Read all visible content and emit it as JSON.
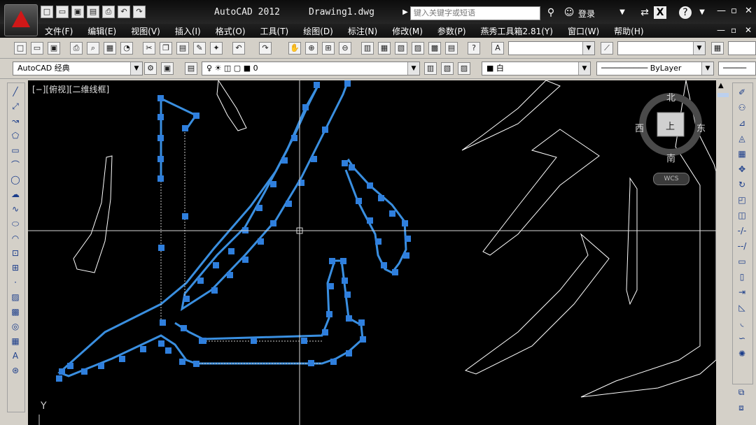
{
  "app": {
    "name": "AutoCAD 2012",
    "document": "Drawing1.dwg",
    "search_placeholder": "键入关键字或短语",
    "login": "登录"
  },
  "menu": [
    "文件(F)",
    "编辑(E)",
    "视图(V)",
    "插入(I)",
    "格式(O)",
    "工具(T)",
    "绘图(D)",
    "标注(N)",
    "修改(M)",
    "参数(P)",
    "燕秀工具箱2.81(Y)",
    "窗口(W)",
    "帮助(H)"
  ],
  "toolbar": {
    "workspace": "AutoCAD 经典",
    "layer": "0",
    "color": "白",
    "linetype": "ByLayer"
  },
  "viewport": {
    "label": "[−][俯视][二维线框]",
    "compass": {
      "north": "北",
      "south": "南",
      "east": "东",
      "west": "西",
      "top": "上"
    },
    "wcs": "WCS",
    "y_axis": "Y"
  },
  "colors": {
    "canvas_bg": "#000000",
    "selection": "#3a8fe0",
    "grip": "#2f7fdd",
    "geometry": "#ffffff",
    "crosshair": "#d8d8d8"
  }
}
